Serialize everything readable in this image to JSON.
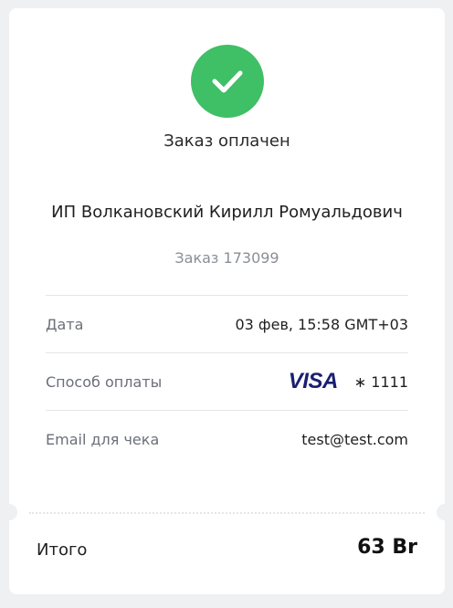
{
  "status": {
    "icon": "checkmark-icon",
    "text": "Заказ оплачен",
    "color": "#3fbf66"
  },
  "merchant": {
    "name": "ИП Волкановский Кирилл Ромуальдович"
  },
  "order": {
    "label": "Заказ",
    "number": "173099"
  },
  "details": {
    "date_label": "Дата",
    "date_value": "03 фев, 15:58 GMT+03",
    "payment_label": "Способ оплаты",
    "payment_brand": "VISA",
    "payment_card": "∗ 1111",
    "email_label": "Email для чека",
    "email_value": "test@test.com"
  },
  "total": {
    "label": "Итого",
    "value": "63 Br"
  }
}
